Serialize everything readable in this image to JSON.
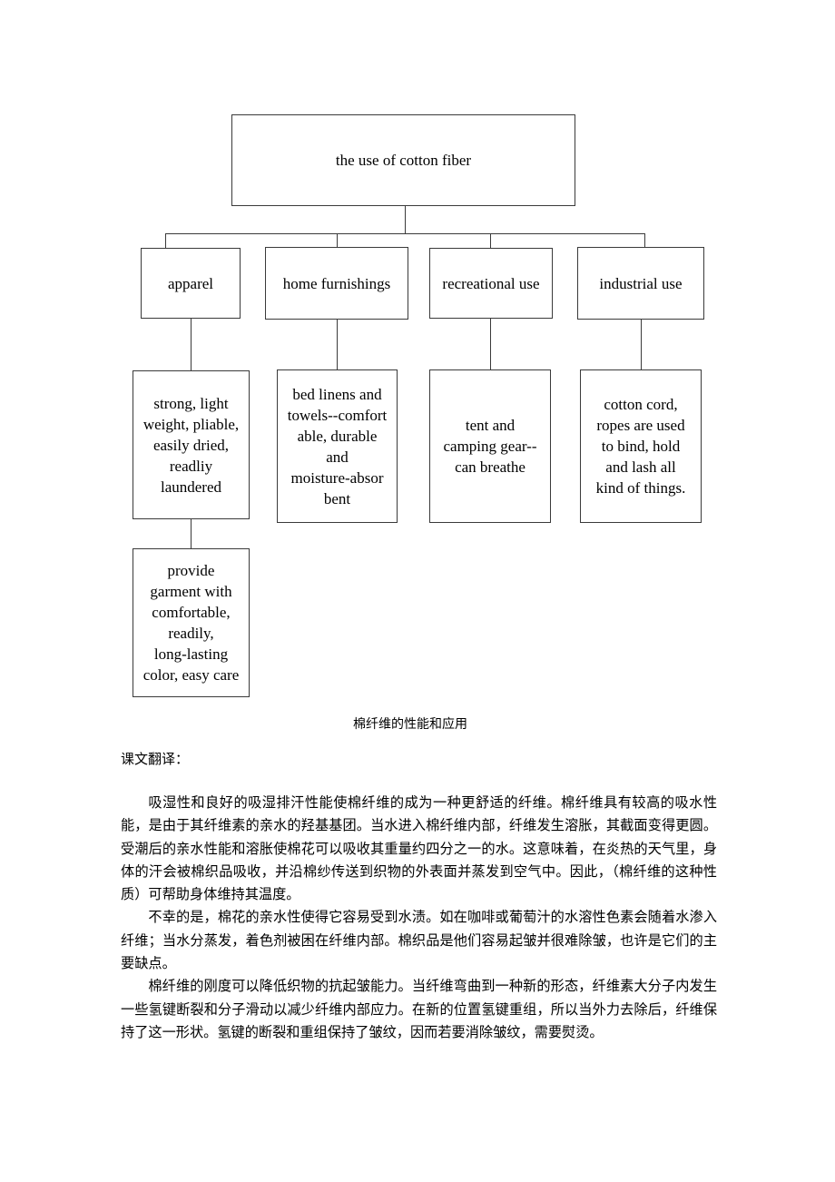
{
  "document": {
    "diagram": {
      "root": {
        "label": "the use of cotton fiber"
      },
      "categories": [
        {
          "label": "apparel"
        },
        {
          "label": "home furnishings"
        },
        {
          "label": "recreational use"
        },
        {
          "label": "industrial use"
        }
      ],
      "details": [
        {
          "label": "strong, light\nweight, pliable,\neasily dried,\nreadliy\nlaundered"
        },
        {
          "label": "bed linens and\ntowels--comfort\nable, durable\nand\nmoisture-absor\nbent"
        },
        {
          "label": "tent and\ncamping gear--\ncan breathe"
        },
        {
          "label": "cotton cord,\nropes are used\nto bind, hold\nand lash all\nkind of things."
        }
      ],
      "subdetails": [
        {
          "label": "provide\ngarment with\ncomfortable,\nreadily,\nlong-lasting\ncolor, easy care"
        }
      ]
    },
    "caption": "棉纤维的性能和应用",
    "subheading": "课文翻译：",
    "paragraphs": [
      "吸湿性和良好的吸湿排汗性能使棉纤维的成为一种更舒适的纤维。棉纤维具有较高的吸水性能，是由于其纤维素的亲水的羟基基团。当水进入棉纤维内部，纤维发生溶胀，其截面变得更圆。受潮后的亲水性能和溶胀使棉花可以吸收其重量约四分之一的水。这意味着，在炎热的天气里，身体的汗会被棉织品吸收，并沿棉纱传送到织物的外表面并蒸发到空气中。因此，（棉纤维的这种性质）可帮助身体维持其温度。",
      "不幸的是，棉花的亲水性使得它容易受到水渍。如在咖啡或葡萄汁的水溶性色素会随着水渗入纤维；当水分蒸发，着色剂被困在纤维内部。棉织品是他们容易起皱并很难除皱，也许是它们的主要缺点。",
      "棉纤维的刚度可以降低织物的抗起皱能力。当纤维弯曲到一种新的形态，纤维素大分子内发生一些氢键断裂和分子滑动以减少纤维内部应力。在新的位置氢键重组，所以当外力去除后，纤维保持了这一形状。氢键的断裂和重组保持了皱纹，因而若要消除皱纹，需要熨烫。"
    ]
  }
}
